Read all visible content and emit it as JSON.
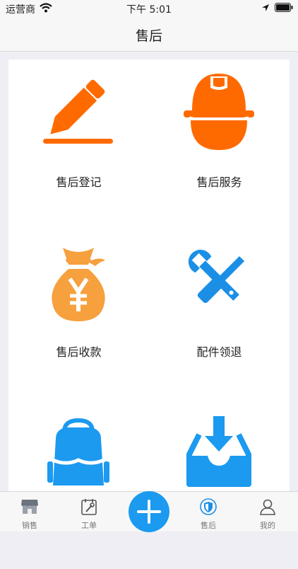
{
  "status_bar": {
    "carrier": "运营商",
    "time": "下午 5:01"
  },
  "nav": {
    "title": "售后"
  },
  "grid": {
    "items": [
      {
        "label": "售后登记",
        "icon": "pencil-icon",
        "color": "#ff6a00"
      },
      {
        "label": "售后服务",
        "icon": "hard-hat-icon",
        "color": "#ff6a00"
      },
      {
        "label": "售后收款",
        "icon": "money-bag-icon",
        "color": "#f6a03e"
      },
      {
        "label": "配件领退",
        "icon": "tools-icon",
        "color": "#1b8fe6"
      },
      {
        "label": "",
        "icon": "backpack-icon",
        "color": "#1b9af0"
      },
      {
        "label": "",
        "icon": "inbox-download-icon",
        "color": "#1b9af0"
      }
    ]
  },
  "tab_bar": {
    "tabs": [
      {
        "label": "销售",
        "icon": "store-icon",
        "active": false
      },
      {
        "label": "工单",
        "icon": "work-order-icon",
        "active": false
      },
      {
        "label": "",
        "icon": "plus-icon",
        "active": false
      },
      {
        "label": "售后",
        "icon": "shield-icon",
        "active": true
      },
      {
        "label": "我的",
        "icon": "user-icon",
        "active": false
      }
    ],
    "active_color": "#1b8fe6",
    "inactive_color": "#777777"
  }
}
